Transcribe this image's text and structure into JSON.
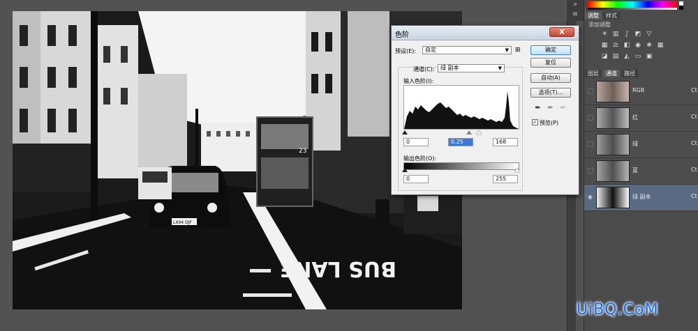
{
  "levels_dialog": {
    "title": "色阶",
    "close_glyph": "X",
    "preset_label": "预设(E):",
    "preset_value": "自定",
    "channel_label": "通道(C):",
    "channel_value": "绿 副本",
    "input_levels_label": "输入色阶(I):",
    "input_black": "0",
    "input_gamma": "0.25",
    "input_white": "168",
    "output_levels_label": "输出色阶(O):",
    "output_black": "0",
    "output_white": "255",
    "buttons": {
      "ok": "确定",
      "reset": "复位",
      "auto": "自动(A)",
      "options": "选项(T)..."
    },
    "preview_label": "预览(P)",
    "preview_checked": true
  },
  "panels": {
    "tabs_top": [
      "调整",
      "样式"
    ],
    "adjustments_title": "添加调整",
    "tabs_channels": [
      "图层",
      "通道",
      "路径"
    ],
    "channels": [
      {
        "name": "RGB",
        "shortcut": "Ct"
      },
      {
        "name": "红",
        "shortcut": "Ct"
      },
      {
        "name": "绿",
        "shortcut": "Ct"
      },
      {
        "name": "蓝",
        "shortcut": "Ct"
      },
      {
        "name": "绿 副本",
        "shortcut": "Ct"
      }
    ],
    "selected_channel": "绿 副本"
  },
  "photo_text": {
    "bus_number": "23",
    "taxi_plate": "LX04 DJF",
    "road_text": "BUS LANE"
  },
  "watermark": "UiBQ.CoM",
  "colors": {
    "selected_row": "#5a6a83",
    "ok_button": "#bfe0f5",
    "close_button": "#c24531",
    "watermark": "#0f6fff"
  }
}
